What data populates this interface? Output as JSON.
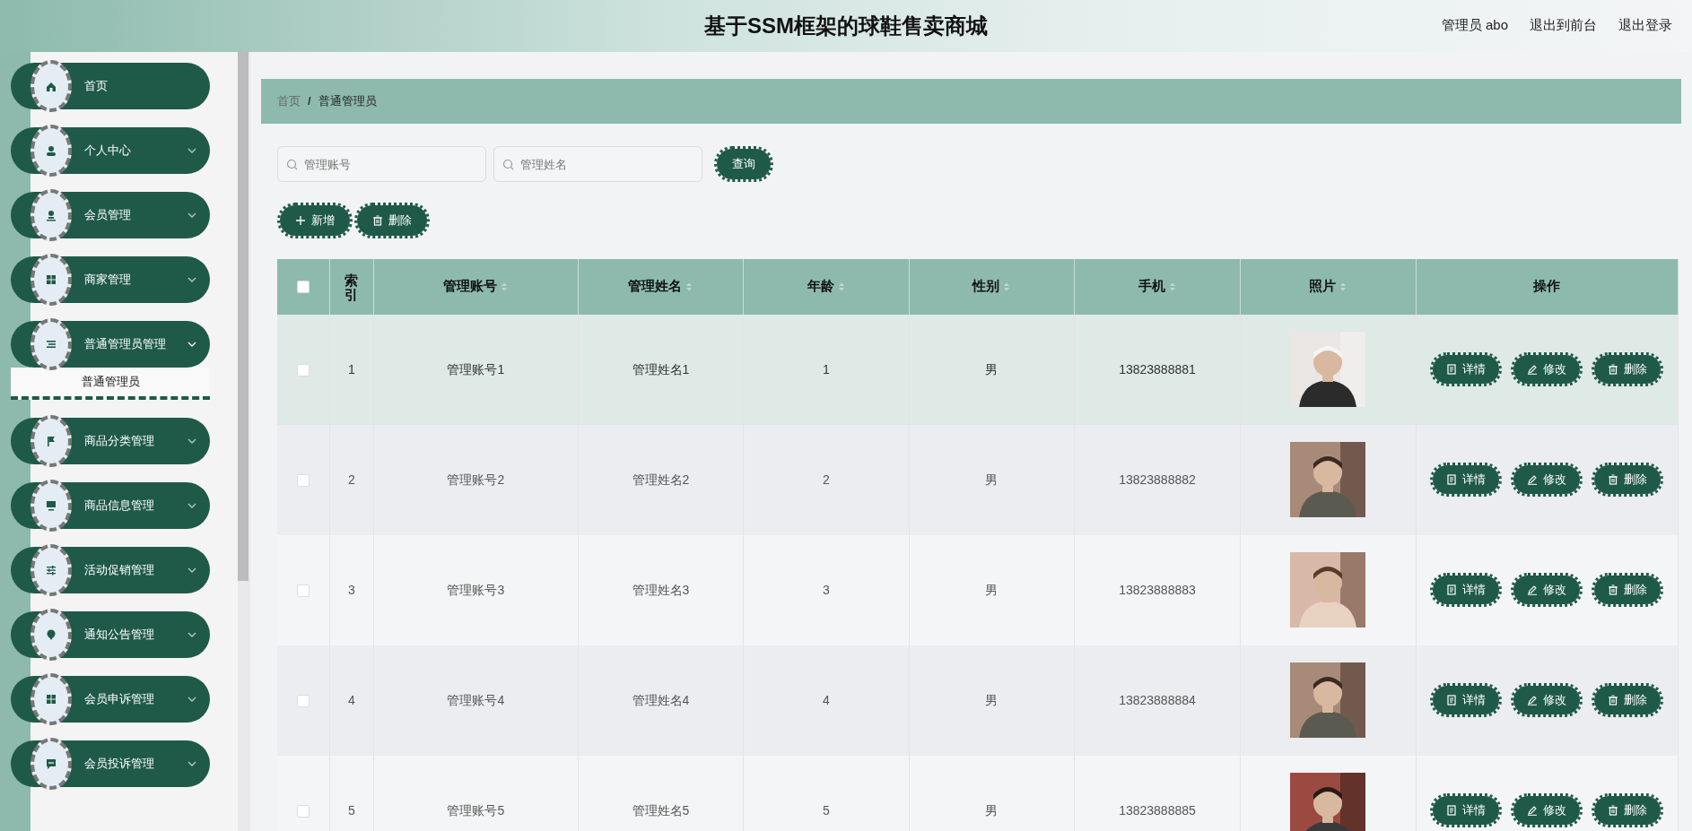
{
  "header": {
    "title": "基于SSM框架的球鞋售卖商城",
    "links": [
      "管理员 abo",
      "退出到前台",
      "退出登录"
    ]
  },
  "sidebar": {
    "items": [
      {
        "label": "首页"
      },
      {
        "label": "个人中心",
        "expanded": false
      },
      {
        "label": "会员管理",
        "expanded": false
      },
      {
        "label": "商家管理",
        "expanded": false
      },
      {
        "label": "普通管理员管理",
        "expanded": true,
        "children": [
          {
            "label": "普通管理员",
            "selected": true
          }
        ]
      },
      {
        "label": "商品分类管理",
        "expanded": false
      },
      {
        "label": "商品信息管理",
        "expanded": false
      },
      {
        "label": "活动促销管理",
        "expanded": false
      },
      {
        "label": "通知公告管理",
        "expanded": false
      },
      {
        "label": "会员申诉管理",
        "expanded": false
      },
      {
        "label": "会员投诉管理",
        "expanded": false
      }
    ]
  },
  "breadcrumb": {
    "items": [
      "首页",
      "普通管理员"
    ],
    "separator": "/"
  },
  "search": {
    "fields": [
      {
        "placeholder": "管理账号"
      },
      {
        "placeholder": "管理姓名"
      }
    ],
    "button": "查询"
  },
  "actions": [
    "新增",
    "删除"
  ],
  "table": {
    "columns": [
      {
        "label": "索引",
        "sortable": false
      },
      {
        "label": "管理账号",
        "sortable": true
      },
      {
        "label": "管理姓名",
        "sortable": true
      },
      {
        "label": "年龄",
        "sortable": true
      },
      {
        "label": "性别",
        "sortable": true
      },
      {
        "label": "手机",
        "sortable": true
      },
      {
        "label": "照片",
        "sortable": true
      },
      {
        "label": "操作",
        "sortable": false
      }
    ],
    "header_checked": false,
    "rows": [
      {
        "index": "1",
        "account": "管理账号1",
        "name": "管理姓名1",
        "age": "1",
        "gender": "男",
        "phone": "13823888881",
        "checked": false,
        "hovered": true,
        "buttons": [
          "详情",
          "修改",
          "删除"
        ]
      },
      {
        "index": "2",
        "account": "管理账号2",
        "name": "管理姓名2",
        "age": "2",
        "gender": "男",
        "phone": "13823888882",
        "checked": false,
        "hovered": false,
        "buttons": [
          "详情",
          "修改",
          "删除"
        ]
      },
      {
        "index": "3",
        "account": "管理账号3",
        "name": "管理姓名3",
        "age": "3",
        "gender": "男",
        "phone": "13823888883",
        "checked": false,
        "hovered": false,
        "buttons": [
          "详情",
          "修改",
          "删除"
        ]
      },
      {
        "index": "4",
        "account": "管理账号4",
        "name": "管理姓名4",
        "age": "4",
        "gender": "男",
        "phone": "13823888884",
        "checked": false,
        "hovered": false,
        "buttons": [
          "详情",
          "修改",
          "删除"
        ]
      },
      {
        "index": "5",
        "account": "管理账号5",
        "name": "管理姓名5",
        "age": "5",
        "gender": "男",
        "phone": "13823888885",
        "checked": false,
        "hovered": false,
        "buttons": [
          "详情",
          "修改",
          "删除"
        ]
      }
    ]
  }
}
